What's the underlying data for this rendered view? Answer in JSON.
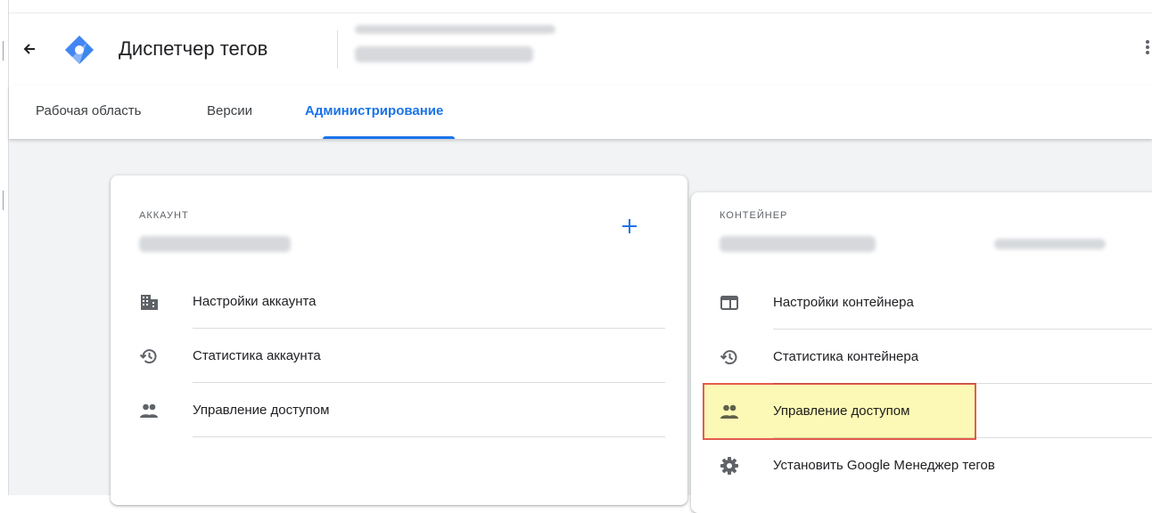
{
  "app": {
    "title": "Диспетчер тегов"
  },
  "tabs": [
    {
      "label": "Рабочая область"
    },
    {
      "label": "Версии"
    },
    {
      "label": "Администрирование"
    }
  ],
  "account": {
    "section_label": "АККАУНТ",
    "items": [
      {
        "label": "Настройки аккаунта",
        "icon": "building-icon"
      },
      {
        "label": "Статистика аккаунта",
        "icon": "history-icon"
      },
      {
        "label": "Управление доступом",
        "icon": "people-icon"
      }
    ]
  },
  "container": {
    "section_label": "КОНТЕЙНЕР",
    "items": [
      {
        "label": "Настройки контейнера",
        "icon": "web-window-icon"
      },
      {
        "label": "Статистика контейнера",
        "icon": "history-icon"
      },
      {
        "label": "Управление доступом",
        "icon": "people-icon",
        "highlighted": true
      },
      {
        "label": "Установить Google Менеджер тегов",
        "icon": "gear-icon"
      }
    ]
  },
  "colors": {
    "accent": "#1a73e8",
    "highlight_fill": "#fcf8b6",
    "highlight_border": "#e35c4e",
    "background": "#f1f3f4"
  }
}
